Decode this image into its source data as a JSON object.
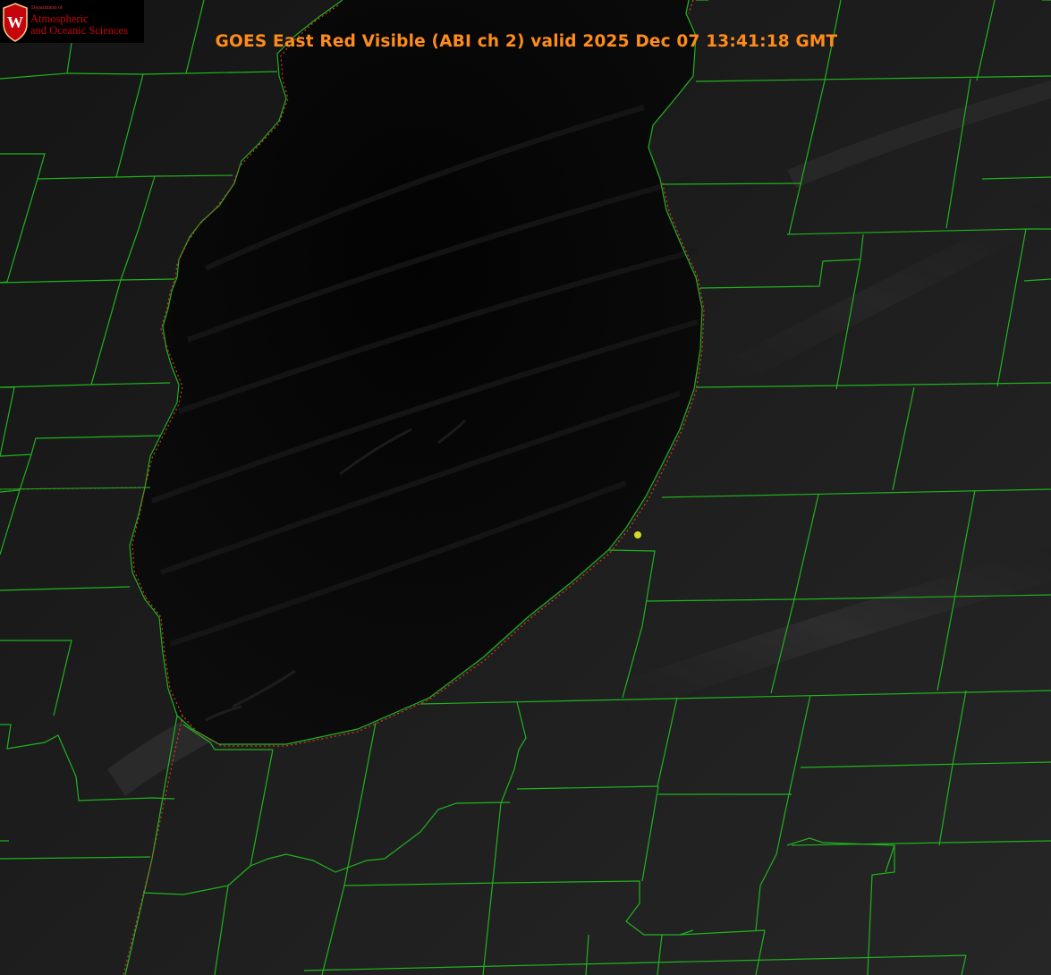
{
  "title": "GOES East Red Visible (ABI ch 2) valid 2025 Dec 07 13:41:18 GMT",
  "logo": {
    "department_line": "Department of",
    "name_line1": "Atmospheric",
    "name_line2": "and Oceanic Sciences",
    "crest_letter": "W"
  },
  "colors": {
    "title": "#ff8c1a",
    "county_lines": "#1fb31f",
    "state_line": "#d83a2a",
    "lake_surface": "#050505",
    "land_background": "#1e1e1e",
    "station_marker": "#d6d62e",
    "logo_red": "#c5050c"
  },
  "map": {
    "features": [
      "lake",
      "county-boundaries",
      "state-boundary",
      "coastline",
      "station-marker"
    ]
  }
}
